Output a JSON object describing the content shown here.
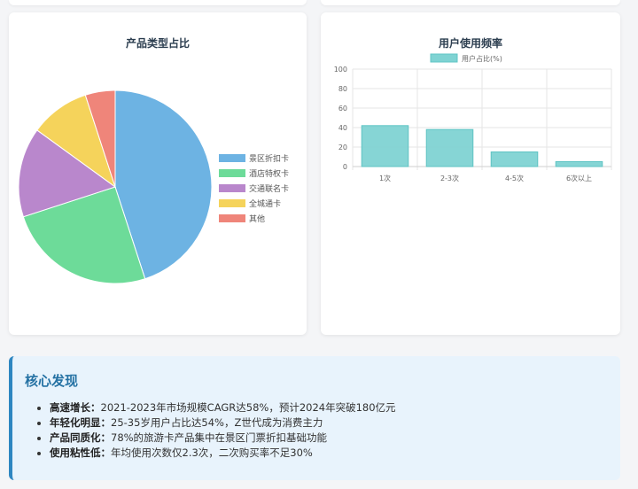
{
  "pie_card": {
    "title": "产品类型占比"
  },
  "bar_card": {
    "title": "用户使用频率"
  },
  "findings": {
    "title": "核心发现",
    "items": [
      {
        "label": "高速增长：",
        "text": "2021-2023年市场规模CAGR达58%，预计2024年突破180亿元"
      },
      {
        "label": "年轻化明显：",
        "text": "25-35岁用户占比达54%，Z世代成为消费主力"
      },
      {
        "label": "产品同质化：",
        "text": "78%的旅游卡产品集中在景区门票折扣基础功能"
      },
      {
        "label": "使用粘性低：",
        "text": "年均使用次数仅2.3次，二次购买率不足30%"
      }
    ]
  },
  "chart_data": [
    {
      "type": "pie",
      "title": "产品类型占比",
      "labels": [
        "景区折扣卡",
        "酒店特权卡",
        "交通联名卡",
        "全城通卡",
        "其他"
      ],
      "values": [
        45,
        25,
        15,
        10,
        5
      ],
      "colors": [
        "#6db3e3",
        "#6ddb99",
        "#b987cc",
        "#f5d35b",
        "#ef857a"
      ],
      "legend_position": "right"
    },
    {
      "type": "bar",
      "title": "用户使用频率",
      "categories": [
        "1次",
        "2-3次",
        "4-5次",
        "6次以上"
      ],
      "series": [
        {
          "name": "用户占比(%)",
          "values": [
            42,
            38,
            15,
            5
          ],
          "color": "#7fd3d3"
        }
      ],
      "ylim": [
        0,
        100
      ],
      "yticks": [
        0,
        20,
        40,
        60,
        80,
        100
      ],
      "grid": true,
      "legend_position": "top"
    }
  ]
}
